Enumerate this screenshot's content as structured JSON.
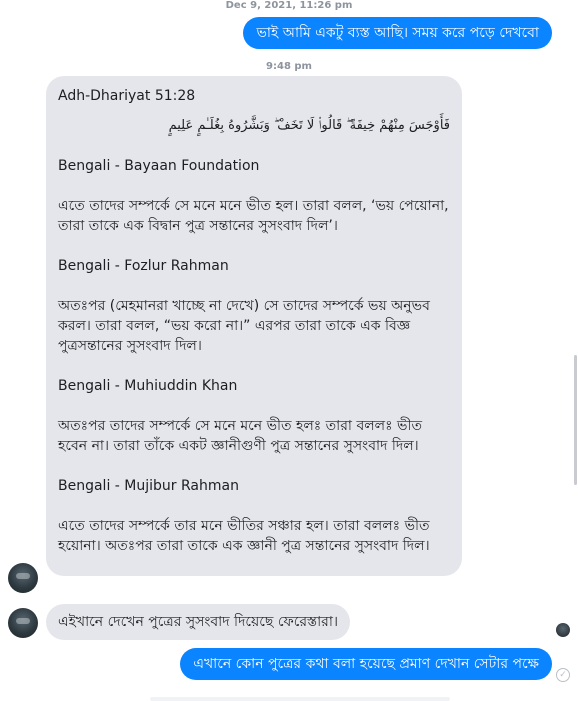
{
  "conversation": {
    "timestamp_1": "Dec 9, 2021, 11:26 pm",
    "timestamp_2": "9:48 pm",
    "msg_out_1": "ভাই আমি একটু ব্যস্ত আছি। সময় করে পড়ে দেখবো",
    "quran_message": {
      "reference": "Adh-Dhariyat 51:28",
      "arabic": "فَأَوْجَسَ مِنْهُمْ خِيفَةً ۖ قَالُوا۟ لَا تَخَفْ ۖ وَبَشَّرُوهُ بِغُلَـٰمٍ عَلِيمٍ",
      "translations": [
        {
          "source": "Bengali - Bayaan Foundation",
          "text": "এতে তাদের সম্পর্কে সে মনে মনে ভীত হল। তারা বলল, ‘ভয় পেয়োনা, তারা তাকে এক বিদ্বান পুত্র সন্তানের সুসংবাদ দিল’।"
        },
        {
          "source": "Bengali - Fozlur Rahman",
          "text": "অতঃপর (মেহমানরা খাচ্ছে না দেখে) সে তাদের সম্পর্কে ভয় অনুভব করল। তারা বলল, “ভয় করো না।” এরপর তারা তাকে এক বিজ্ঞ পুত্রসন্তানের সুসংবাদ দিল।"
        },
        {
          "source": "Bengali - Muhiuddin Khan",
          "text": "অতঃপর তাদের সম্পর্কে সে মনে মনে ভীত হলঃ তারা বললঃ ভীত হবেন না। তারা তাঁকে একট জ্ঞানীগুণী পুত্র সন্তানের সুসংবাদ দিল।"
        },
        {
          "source": "Bengali - Mujibur Rahman",
          "text": "এতে তাদের সম্পর্কে তার মনে ভীতির সঞ্চার হল। তারা বললঃ ভীত হয়োনা। অতঃপর তারা তাকে এক জ্ঞানী পুত্র সন্তানের সুসংবাদ দিল।"
        }
      ]
    },
    "msg_in_2": "এইখানে দেখেন পুত্রের সুসংবাদ দিয়েছে ফেরেস্তারা।",
    "msg_out_2": "এখানে কোন পুত্রের কথা বলা হয়েছে প্রমাণ দেখান সেটার পক্ষে",
    "accent_color": "#0a84ff",
    "incoming_bubble_color": "#e4e6eb"
  }
}
